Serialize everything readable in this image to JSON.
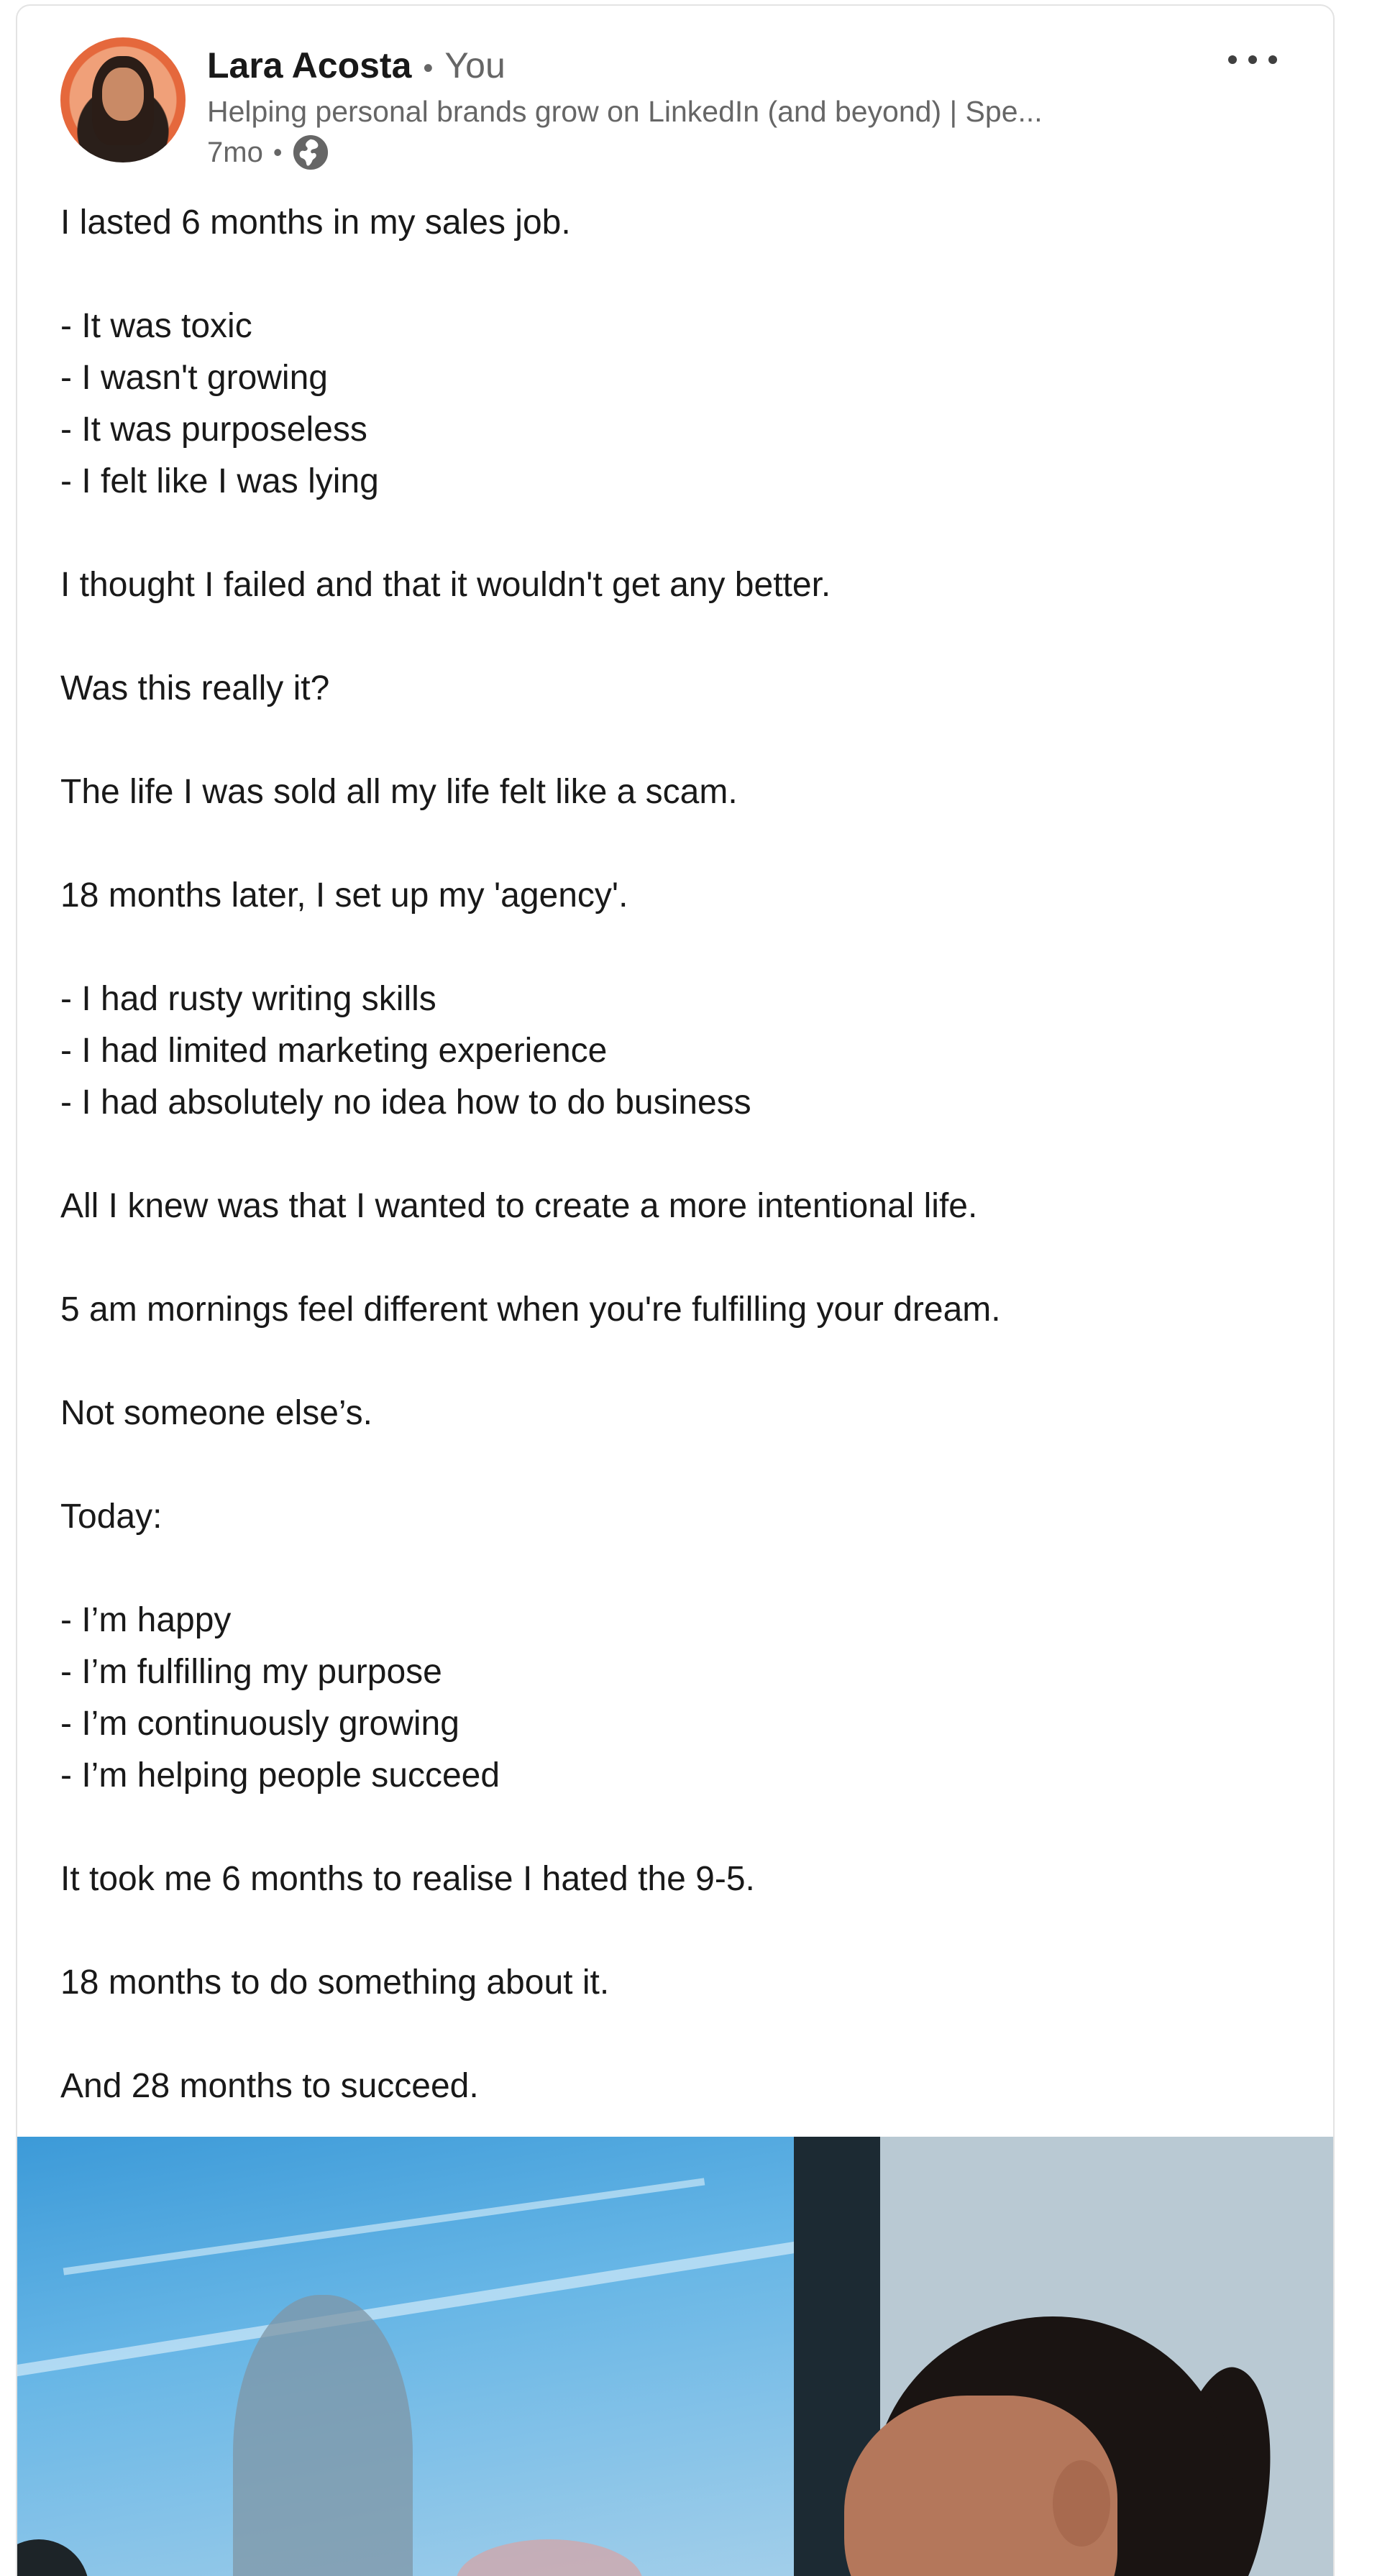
{
  "author": {
    "name": "Lara Acosta",
    "separator": "•",
    "relation": "You",
    "headline": "Helping personal brands grow on LinkedIn (and beyond) | Spe...",
    "time": "7mo",
    "time_separator": "•",
    "visibility_icon": "globe-icon",
    "more_icon": "ellipsis-icon"
  },
  "post": {
    "lines": [
      "I lasted 6 months in my sales job.",
      "",
      "- It was toxic",
      "- I wasn't growing",
      "- It was purposeless",
      "- I felt like I was lying",
      "",
      "I thought I failed and that it wouldn't get any better.",
      "",
      "Was this really it?",
      "",
      "The life I was sold all my life felt like a scam.",
      "",
      "18 months later, I set up my 'agency'.",
      "",
      "- I had rusty writing skills",
      "- I had limited marketing experience",
      "- I had absolutely no idea how to do business",
      "",
      "All I knew was that I wanted to create a more intentional life.",
      "",
      "5 am mornings feel different when you're fulfilling your dream.",
      "",
      "Not someone else’s.",
      "",
      "Today:",
      "",
      "- I’m happy",
      "- I’m fulfilling my purpose",
      "- I’m continuously growing",
      "- I’m helping people succeed",
      "",
      "It took me 6 months to realise I hated the 9-5.",
      "",
      "18 months to do something about it.",
      "",
      "And 28 months to succeed."
    ]
  },
  "colors": {
    "text": "#191919",
    "muted": "#666666",
    "border": "#e3e3e3"
  }
}
